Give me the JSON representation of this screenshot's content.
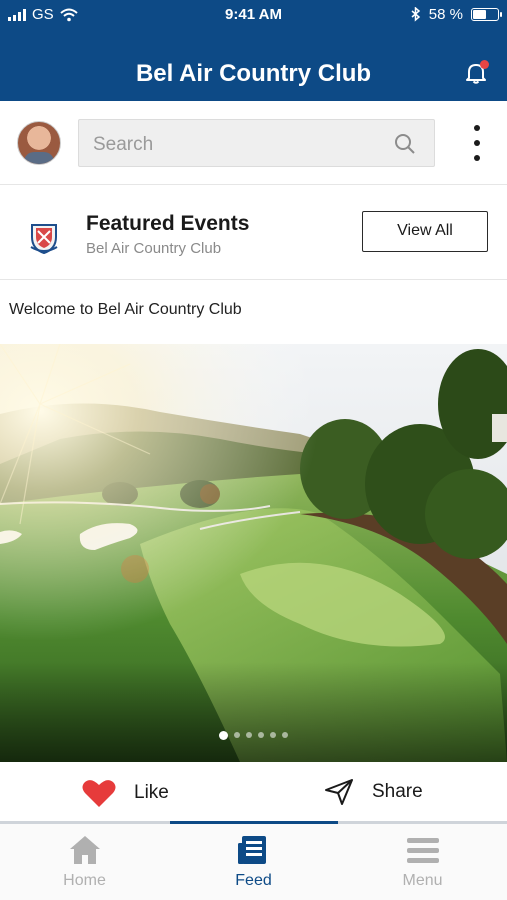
{
  "status_bar": {
    "carrier": "GS",
    "time": "9:41 AM",
    "battery": "58 %",
    "battery_level": 0.58
  },
  "header": {
    "title": "Bel Air Country Club",
    "notification_icon": "bell-icon",
    "has_notification": true
  },
  "search": {
    "placeholder": "Search",
    "icon": "search-icon"
  },
  "featured": {
    "title": "Featured Events",
    "subtitle": "Bel Air Country Club",
    "view_all_label": "View All"
  },
  "post": {
    "text": "Welcome to Bel Air Country Club",
    "carousel_count": 6,
    "carousel_active": 0
  },
  "actions": {
    "like_label": "Like",
    "share_label": "Share"
  },
  "tabs": [
    {
      "label": "Home",
      "icon": "home-icon",
      "active": false
    },
    {
      "label": "Feed",
      "icon": "feed-icon",
      "active": true
    },
    {
      "label": "Menu",
      "icon": "menu-icon",
      "active": false
    }
  ],
  "colors": {
    "brand": "#0d4a86",
    "like": "#e63b3b",
    "inactive_tab": "#b0b0b0"
  }
}
